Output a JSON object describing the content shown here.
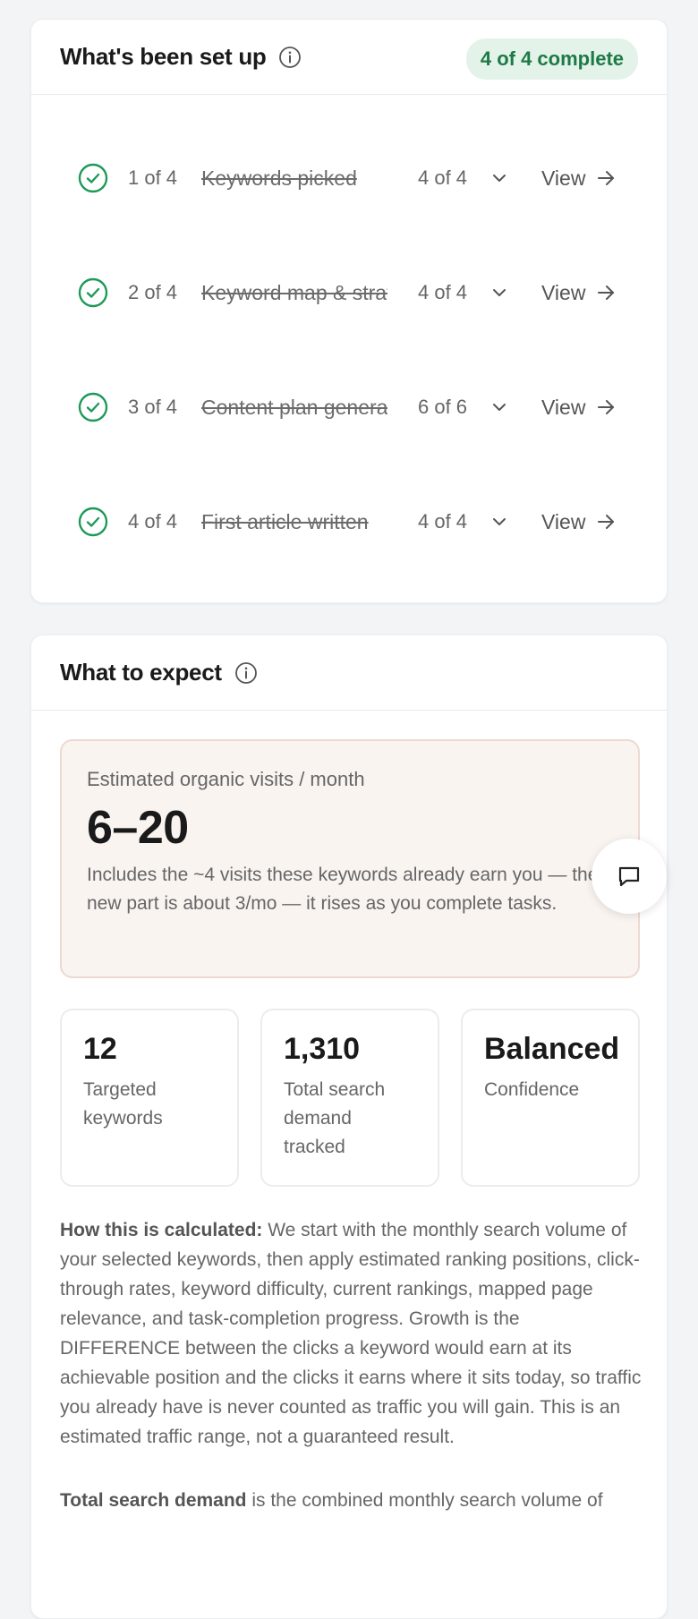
{
  "setup": {
    "title": "What's been set up",
    "badge": "4 of 4 complete",
    "steps": [
      {
        "num": "1 of 4",
        "name": "Keywords picked",
        "count": "4 of 4",
        "view": "View"
      },
      {
        "num": "2 of 4",
        "name": "Keyword map & strategy",
        "count": "4 of 4",
        "view": "View"
      },
      {
        "num": "3 of 4",
        "name": "Content plan generated",
        "count": "6 of 6",
        "view": "View"
      },
      {
        "num": "4 of 4",
        "name": "First article written",
        "count": "4 of 4",
        "view": "View"
      }
    ]
  },
  "expect": {
    "title": "What to expect",
    "estimate_label": "Estimated organic visits / month",
    "estimate_value": "6–20",
    "estimate_note": "Includes the ~4 visits these keywords already earn you — the new part is about 3/mo — it rises as you complete tasks.",
    "stats": [
      {
        "value": "12",
        "label": "Targeted keywords"
      },
      {
        "value": "1,310",
        "label": "Total search demand tracked"
      },
      {
        "value": "Balanced",
        "label": "Confidence"
      }
    ],
    "calc_label": "How this is calculated:",
    "calc_text": " We start with the monthly search volume of your selected keywords, then apply estimated ranking positions, click-through rates, keyword difficulty, current rankings, mapped page relevance, and task-completion progress. Growth is the DIFFERENCE between the clicks a keyword would earn at its achievable position and the clicks it earns where it sits today, so traffic you already have is never counted as traffic you will gain. This is an estimated traffic range, not a guaranteed result.",
    "demand_label": "Total search demand",
    "demand_text": " is the combined monthly search volume of"
  },
  "colors": {
    "accent_green": "#1e9a58",
    "badge_bg": "#e3f3ea",
    "estimate_bg": "#faf4f1"
  },
  "icons": [
    "info-icon",
    "check-circle-icon",
    "chevron-down-icon",
    "arrow-right-icon",
    "chat-icon"
  ]
}
